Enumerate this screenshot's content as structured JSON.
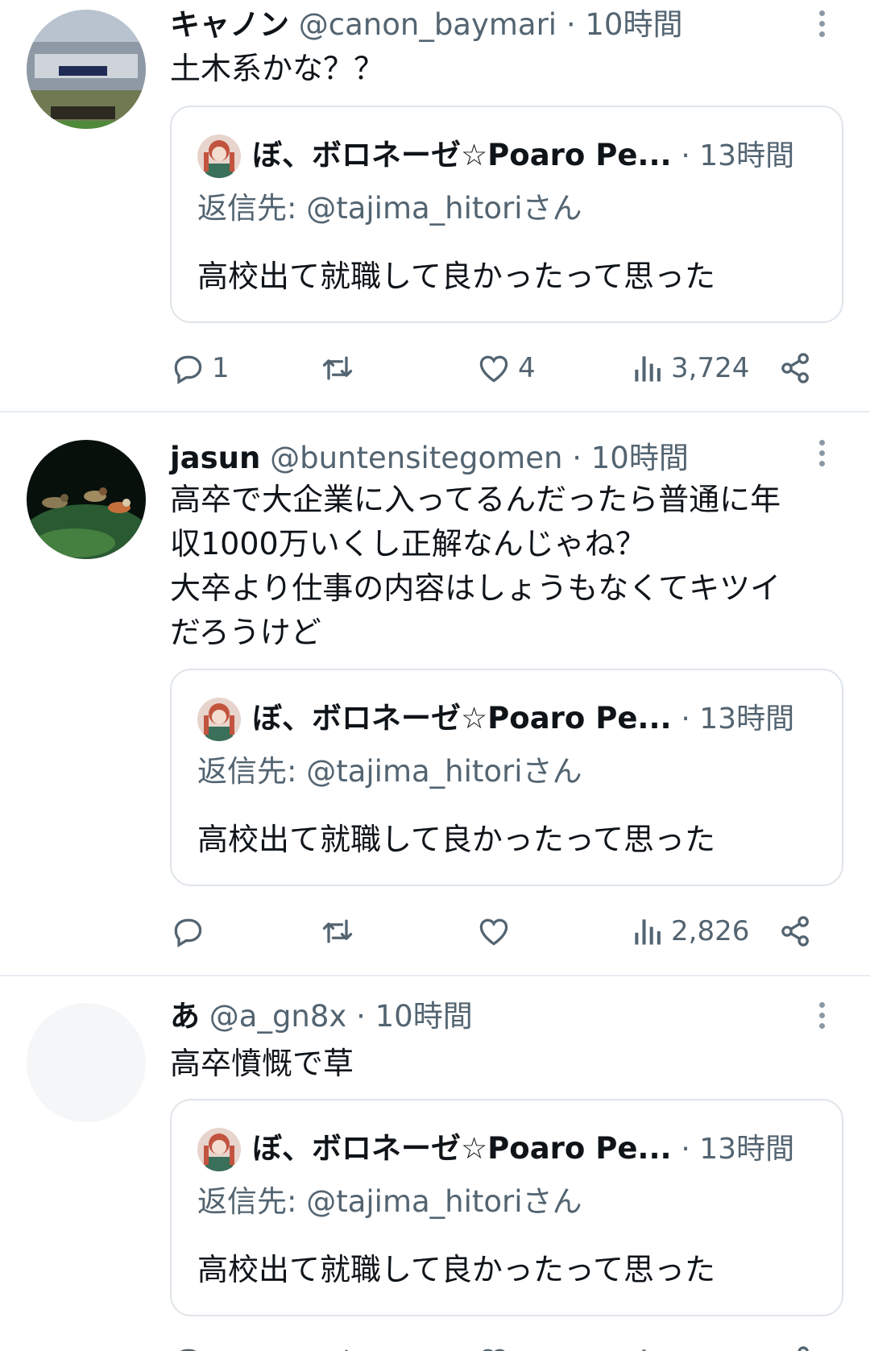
{
  "tweets": [
    {
      "name": "キャノン",
      "handle": "@canon_baymari",
      "time": "10時間",
      "text_lines": [
        "土木系かな？？"
      ],
      "quote": {
        "name": "ぼ、ボロネーゼ☆Poaro Pe...",
        "time": "13時間",
        "reply_to": "返信先: @tajima_hitoriさん",
        "text": "高校出て就職して良かったって思った"
      },
      "replies": "1",
      "retweets": "",
      "likes": "4",
      "views": "3,724"
    },
    {
      "name": "jasun",
      "handle": "@buntensitegomen",
      "time": "10時間",
      "text_lines": [
        "高卒で大企業に入ってるんだったら普通に年",
        "収1000万いくし正解なんじゃね？",
        "大卒より仕事の内容はしょうもなくてキツイ",
        "だろうけど"
      ],
      "quote": {
        "name": "ぼ、ボロネーゼ☆Poaro Pe...",
        "time": "13時間",
        "reply_to": "返信先: @tajima_hitoriさん",
        "text": "高校出て就職して良かったって思った"
      },
      "replies": "",
      "retweets": "",
      "likes": "",
      "views": "2,826"
    },
    {
      "name": "あ",
      "handle": "@a_gn8x",
      "time": "10時間",
      "text_lines": [
        "高卒憤慨で草"
      ],
      "quote": {
        "name": "ぼ、ボロネーゼ☆Poaro Pe...",
        "time": "13時間",
        "reply_to": "返信先: @tajima_hitoriさん",
        "text": "高校出て就職して良かったって思った"
      },
      "replies": "",
      "retweets": "",
      "likes": "",
      "views": ""
    }
  ],
  "separator": "·",
  "icons": {
    "reply": "reply-icon",
    "retweet": "retweet-icon",
    "like": "heart-icon",
    "views": "views-icon",
    "share": "share-icon",
    "more": "more-vertical-icon"
  },
  "colors": {
    "text": "#0f1419",
    "secondary": "#536471",
    "border": "#dfe5ea"
  }
}
